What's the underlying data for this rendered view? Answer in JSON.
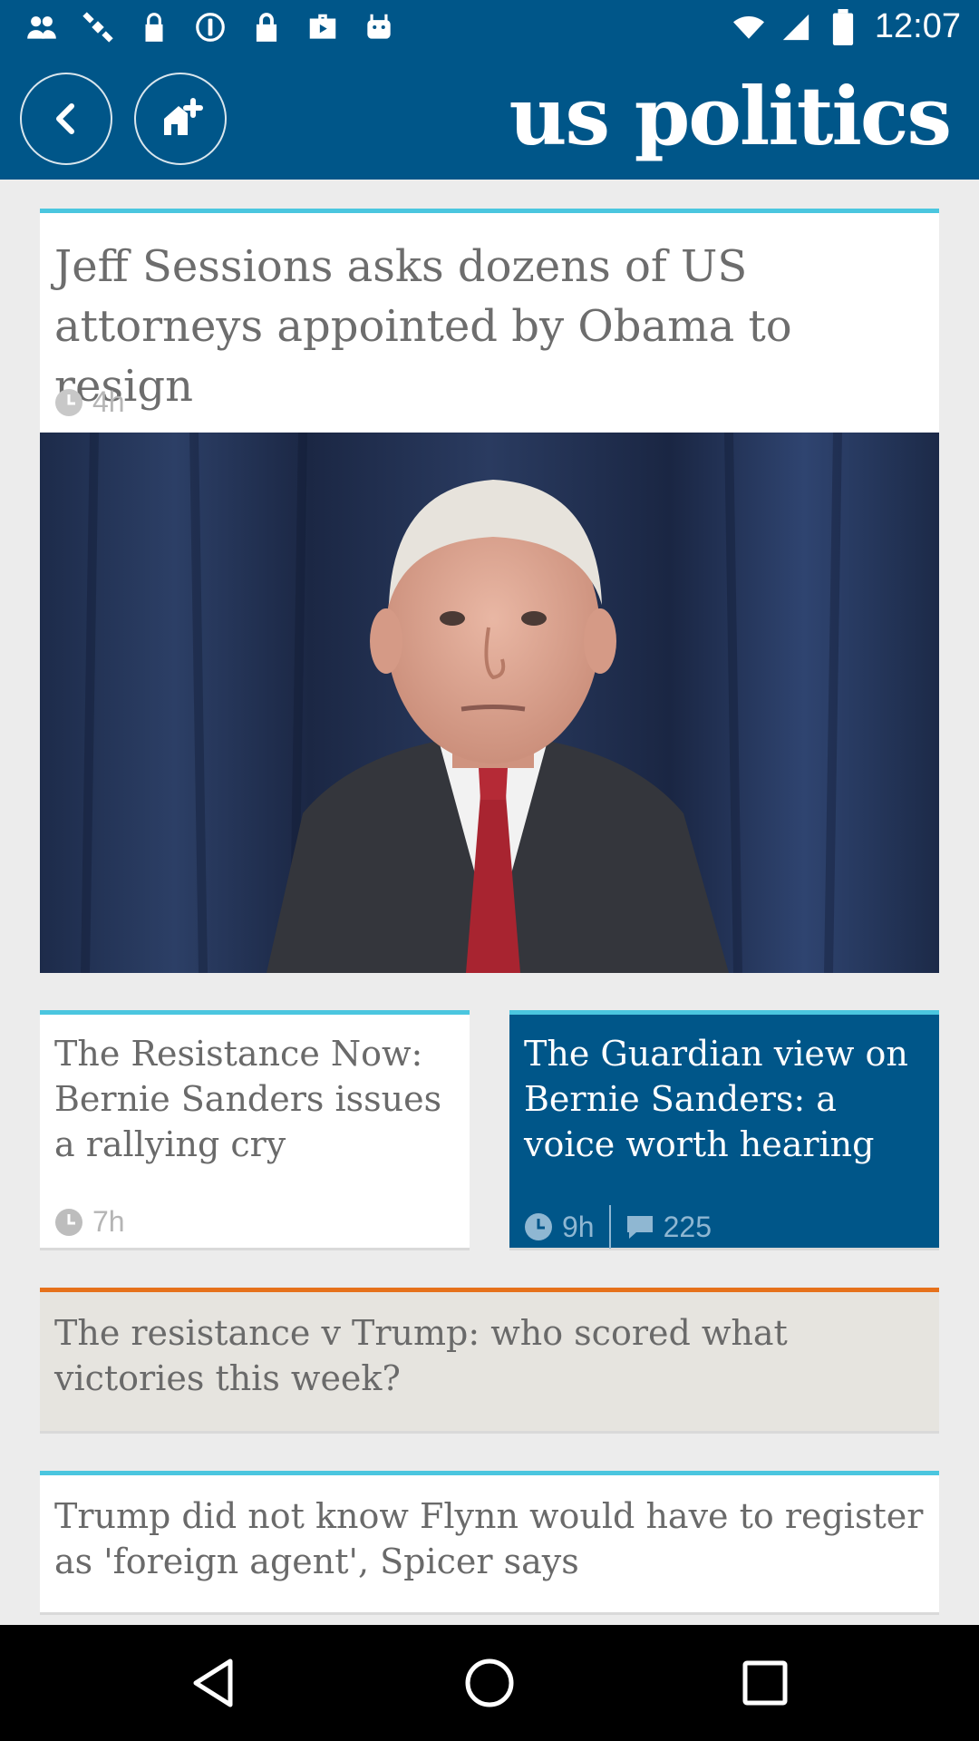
{
  "status_bar": {
    "time": "12:07",
    "left_icons": [
      "people-icon",
      "satellite-icon",
      "location-lock-icon",
      "circle-info-icon",
      "lock-icon",
      "briefcase-play-icon",
      "android-icon"
    ],
    "right_icons": [
      "wifi-icon",
      "signal-icon",
      "battery-icon"
    ]
  },
  "header": {
    "title": "us politics",
    "back_icon": "chevron-left-icon",
    "home_icon": "home-plus-icon",
    "background": "#005689"
  },
  "articles": {
    "main": {
      "headline": "Jeff Sessions asks dozens of US attorneys appointed by Obama to resign",
      "age": "4h"
    },
    "left": {
      "headline": "The Resistance Now: Bernie Sanders issues a rallying cry",
      "age": "7h"
    },
    "right": {
      "headline": "The Guardian view on Bernie Sanders: a voice worth hearing",
      "age": "9h",
      "comments": "225"
    },
    "orange": {
      "headline": "The resistance v Trump: who scored what victories this week?"
    },
    "flynn": {
      "headline": "Trump did not know Flynn would have to register as 'foreign agent', Spicer says"
    }
  },
  "colors": {
    "guardian_blue": "#005689",
    "accent_teal": "#4bc6df",
    "accent_orange": "#e6711b"
  },
  "nav_bar": {
    "icons": [
      "back-triangle-icon",
      "home-circle-icon",
      "recents-square-icon"
    ]
  }
}
